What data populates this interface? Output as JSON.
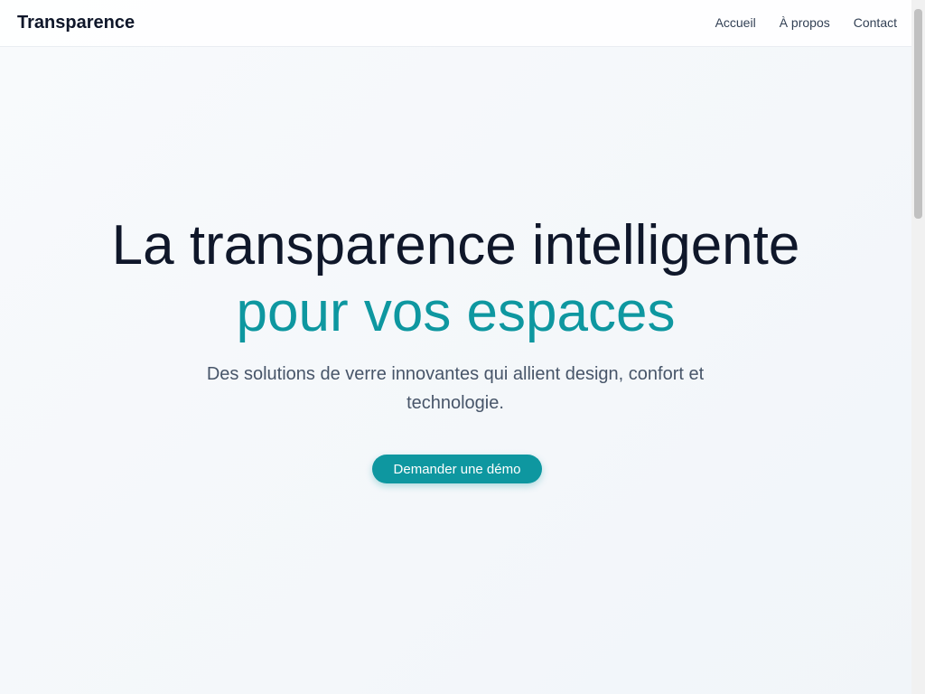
{
  "header": {
    "logo": "Transparence",
    "nav": [
      "Accueil",
      "À propos",
      "Contact"
    ]
  },
  "hero": {
    "title_line1": "La transparence intelligente",
    "title_line2": "pour vos espaces",
    "subtitle": "Des solutions de verre innovantes qui allient design, confort et technologie.",
    "cta_label": "Demander une démo"
  },
  "colors": {
    "accent": "#0e97a0",
    "heading": "#0f172a",
    "body_text": "#475569"
  }
}
